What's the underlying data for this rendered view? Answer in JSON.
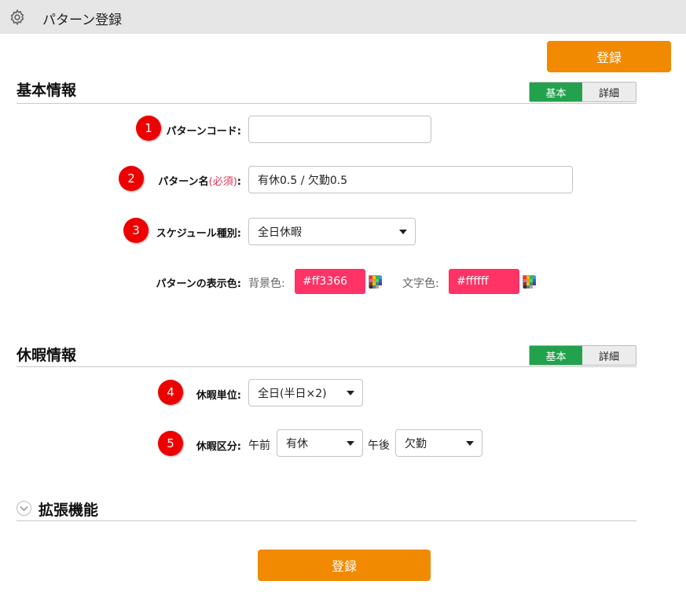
{
  "header": {
    "title": "パターン登録",
    "icon": "gear-icon"
  },
  "actions": {
    "register_label": "登録"
  },
  "sections": {
    "basic": {
      "title": "基本情報",
      "toggle": {
        "basic_label": "基本",
        "detail_label": "詳細"
      }
    },
    "leave": {
      "title": "休暇情報",
      "toggle": {
        "basic_label": "基本",
        "detail_label": "詳細"
      }
    },
    "extension": {
      "title": "拡張機能"
    }
  },
  "fields": {
    "pattern_code": {
      "badge": "1",
      "label": "パターンコード",
      "colon": ":",
      "value": ""
    },
    "pattern_name": {
      "badge": "2",
      "label": "パターン名",
      "required": "(必須)",
      "colon": ":",
      "value": "有休0.5 / 欠勤0.5"
    },
    "schedule_type": {
      "badge": "3",
      "label": "スケジュール種別",
      "colon": ":",
      "value": "全日休暇"
    },
    "display_color": {
      "label": "パターンの表示色",
      "colon": ":",
      "bg_label": "背景色:",
      "bg_value": "#ff3366",
      "text_label": "文字色:",
      "text_value": "#ffffff",
      "bg_swatch": "#ff3366"
    },
    "leave_unit": {
      "badge": "4",
      "label": "休暇単位",
      "colon": ":",
      "value": "全日(半日×2)"
    },
    "leave_type": {
      "badge": "5",
      "label": "休暇区分",
      "colon": ":",
      "am_label": "午前",
      "am_value": "有休",
      "pm_label": "午後",
      "pm_value": "欠勤"
    }
  },
  "colors": {
    "accent": "#f18a00",
    "toggle_active": "#23a24d",
    "badge": "#ee0000",
    "required": "#e0335a"
  }
}
